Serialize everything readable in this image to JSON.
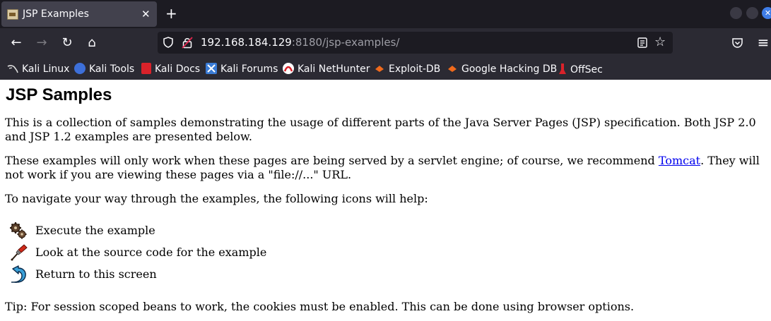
{
  "browser": {
    "tab": {
      "title": "JSP Examples",
      "close_glyph": "✕",
      "favicon": "tomcat-favicon"
    },
    "new_tab_glyph": "+",
    "window_controls": [
      "minimize",
      "maximize",
      "close"
    ],
    "close_glyph": "✕",
    "nav": {
      "back_glyph": "←",
      "forward_glyph": "→",
      "reload_glyph": "↻",
      "home_glyph": "⌂"
    },
    "url": {
      "host": "192.168.184.129",
      "port_and_path": ":8180/jsp-examples/"
    },
    "star_glyph": "☆",
    "pocket_glyph": "◡",
    "menu_glyph": "≡"
  },
  "bookmarks": [
    {
      "label": "Kali Linux",
      "icon": "kali-dragon-icon",
      "color": "#e0e0e0"
    },
    {
      "label": "Kali Tools",
      "icon": "kali-tools-icon",
      "color": "#3d6fd9"
    },
    {
      "label": "Kali Docs",
      "icon": "kali-docs-icon",
      "color": "#d9222a"
    },
    {
      "label": "Kali Forums",
      "icon": "kali-forums-icon",
      "color": "#3a7bd5"
    },
    {
      "label": "Kali NetHunter",
      "icon": "nethunter-icon",
      "color": "#d9222a"
    },
    {
      "label": "Exploit-DB",
      "icon": "exploit-db-icon",
      "color": "#f06a1c"
    },
    {
      "label": "Google Hacking DB",
      "icon": "ghdb-icon",
      "color": "#f06a1c"
    },
    {
      "label": "OffSec",
      "icon": "offsec-icon",
      "color": "#d9222a"
    }
  ],
  "page": {
    "title": "JSP Samples",
    "intro": "This is a collection of samples demonstrating the usage of different parts of the Java Server Pages (JSP) specification. Both JSP 2.0 and JSP 1.2 examples are presented below.",
    "servlet_note_before": "These examples will only work when these pages are being served by a servlet engine; of course, we recommend ",
    "servlet_note_link": "Tomcat",
    "servlet_note_after": ". They will not work if you are viewing these pages via a \"file://...\" URL.",
    "navigate_text": "To navigate your way through the examples, the following icons will help:",
    "icon_legend": [
      {
        "icon": "execute-gears-icon",
        "label": "Execute the example"
      },
      {
        "icon": "view-source-pen-icon",
        "label": "Look at the source code for the example"
      },
      {
        "icon": "return-arrow-icon",
        "label": "Return to this screen"
      }
    ],
    "tip": "Tip: For session scoped beans to work, the cookies must be enabled. This can be done using browser options."
  }
}
